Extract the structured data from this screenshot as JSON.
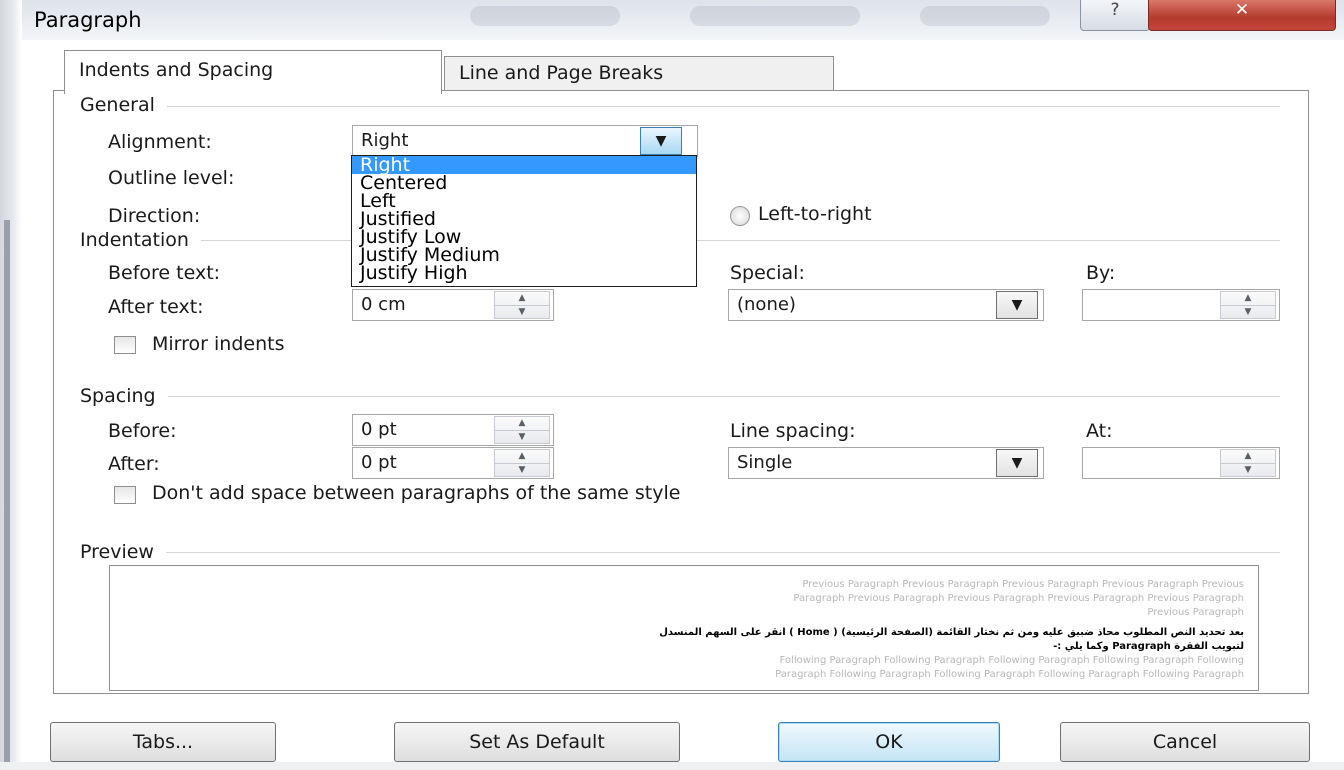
{
  "window": {
    "title": "Paragraph",
    "help_glyph": "?",
    "close_glyph": "✕"
  },
  "tabs": [
    {
      "label": "Indents and Spacing",
      "active": true
    },
    {
      "label": "Line and Page Breaks",
      "active": false
    }
  ],
  "general": {
    "title": "General",
    "alignment_label": "Alignment:",
    "alignment_value": "Right",
    "alignment_options": [
      "Right",
      "Centered",
      "Left",
      "Justified",
      "Justify Low",
      "Justify Medium",
      "Justify High"
    ],
    "outline_label": "Outline level:",
    "direction_label": "Direction:",
    "direction_option": "Left-to-right"
  },
  "indentation": {
    "title": "Indentation",
    "before_label": "Before text:",
    "after_label": "After text:",
    "after_value": "0 cm",
    "special_label": "Special:",
    "special_value": "(none)",
    "by_label": "By:",
    "by_value": "",
    "mirror_label": "Mirror indents"
  },
  "spacing": {
    "title": "Spacing",
    "before_label": "Before:",
    "before_value": "0 pt",
    "after_label": "After:",
    "after_value": "0 pt",
    "line_spacing_label": "Line spacing:",
    "line_spacing_value": "Single",
    "at_label": "At:",
    "at_value": "",
    "no_space_label": "Don't add space between paragraphs of the same style"
  },
  "preview": {
    "title": "Preview",
    "previous_line1": "Previous Paragraph Previous Paragraph Previous Paragraph Previous Paragraph Previous",
    "previous_line2": "Paragraph Previous Paragraph Previous Paragraph Previous Paragraph Previous Paragraph",
    "previous_line3": "Previous Paragraph",
    "sample_line1": "بعد تحديد النص المطلوب محاذ ضبيق عليه ومن ثم نختار القائمة (الصفحة الرئيسية) ( Home ) انقر على السهم المنسدل",
    "sample_line2": "لتبويب الفقرة Paragraph وكما يلي :-",
    "following_line1": "Following Paragraph Following Paragraph Following Paragraph Following Paragraph Following",
    "following_line2": "Paragraph Following Paragraph Following Paragraph Following Paragraph Following Paragraph"
  },
  "buttons": {
    "tabs": "Tabs...",
    "set_default": "Set As Default",
    "ok": "OK",
    "cancel": "Cancel"
  },
  "icons": {
    "dropdown_arrow": "▼",
    "spin_up": "▲",
    "spin_down": "▼"
  }
}
